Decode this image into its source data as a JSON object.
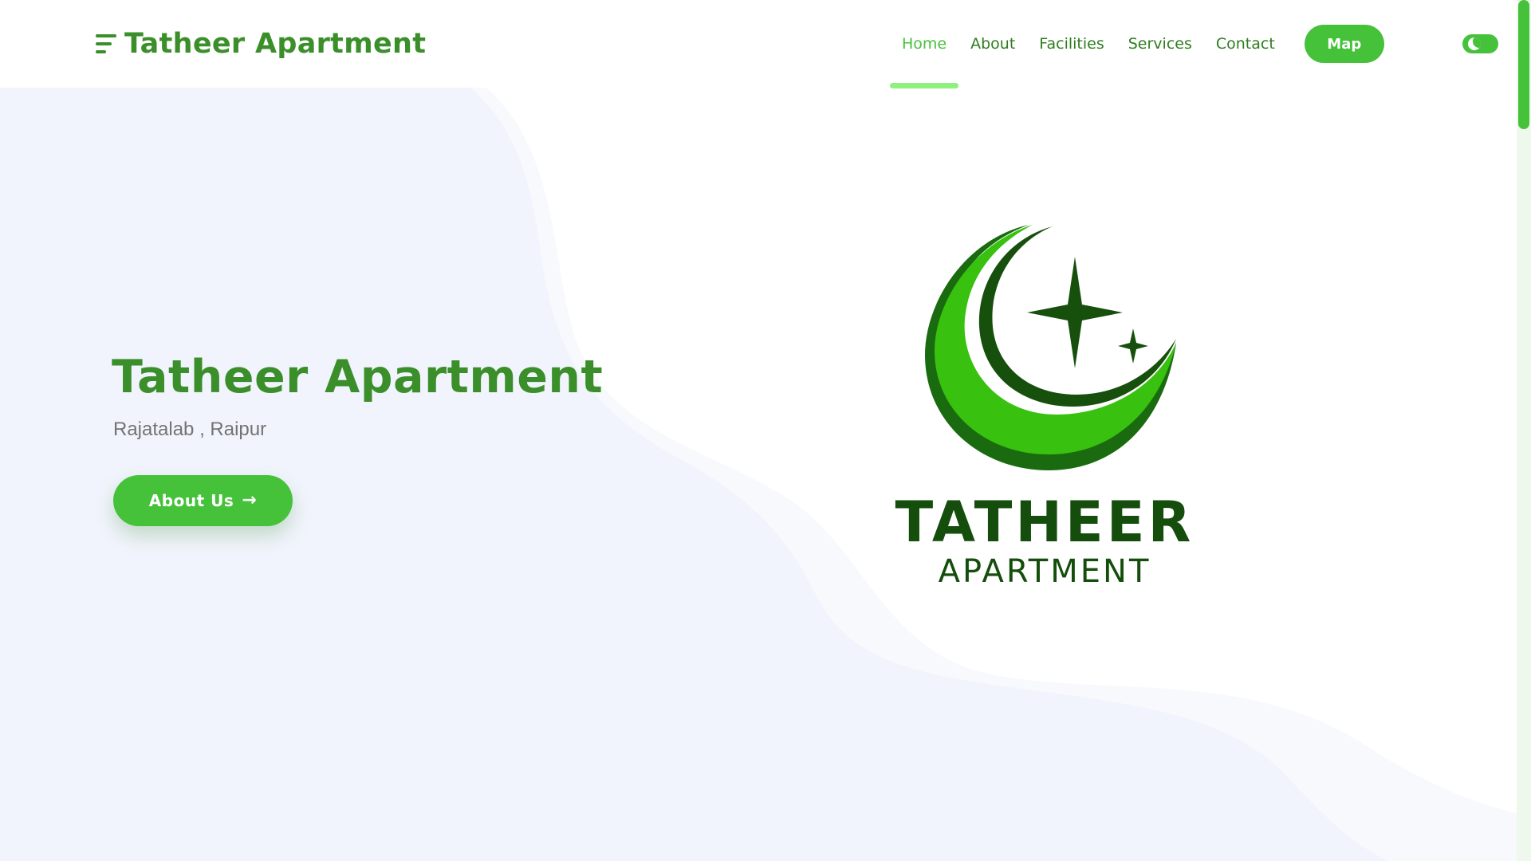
{
  "header": {
    "brand_name": "Tatheer Apartment",
    "nav_items": [
      {
        "label": "Home",
        "active": true
      },
      {
        "label": "About",
        "active": false
      },
      {
        "label": "Facilities",
        "active": false
      },
      {
        "label": "Services",
        "active": false
      },
      {
        "label": "Contact",
        "active": false
      }
    ],
    "map_label": "Map",
    "theme_toggle_icon": "moon-icon"
  },
  "hero": {
    "title": "Tatheer Apartment",
    "subtitle": "Rajatalab , Raipur",
    "button_label": "About Us",
    "button_icon": "arrow-right-icon"
  },
  "logo": {
    "word_top": "TATHEER",
    "word_bottom": "APARTMENT",
    "icon": "crescent-star-icon"
  },
  "colors": {
    "brand_green": "#3b8f2b",
    "accent_green": "#45c23a",
    "nav_text": "#2f7d1f",
    "active_underline": "#8ef07d",
    "logo_dark": "#144d0c",
    "background_wave": "#f1f4fc",
    "subtitle_gray": "#737373"
  }
}
